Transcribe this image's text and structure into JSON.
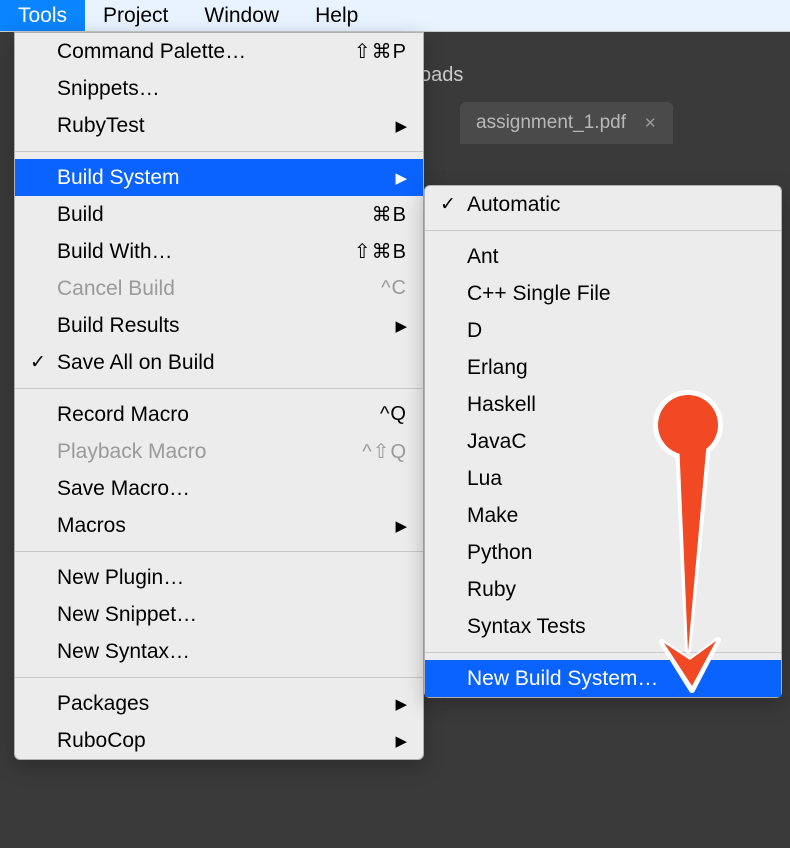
{
  "menubar": {
    "items": [
      {
        "label": "Tools",
        "active": true
      },
      {
        "label": "Project",
        "active": false
      },
      {
        "label": "Window",
        "active": false
      },
      {
        "label": "Help",
        "active": false
      }
    ]
  },
  "breadcrumb": "oads",
  "tab": {
    "label": "assignment_1.pdf",
    "close_glyph": "✕"
  },
  "tools_menu": {
    "groups": [
      [
        {
          "label": "Command Palette…",
          "shortcut": "⇧⌘P"
        },
        {
          "label": "Snippets…"
        },
        {
          "label": "RubyTest",
          "submenu": true
        }
      ],
      [
        {
          "label": "Build System",
          "submenu": true,
          "highlighted": true
        },
        {
          "label": "Build",
          "shortcut": "⌘B"
        },
        {
          "label": "Build With…",
          "shortcut": "⇧⌘B"
        },
        {
          "label": "Cancel Build",
          "shortcut": "^C",
          "disabled": true
        },
        {
          "label": "Build Results",
          "submenu": true
        },
        {
          "label": "Save All on Build",
          "checked": true
        }
      ],
      [
        {
          "label": "Record Macro",
          "shortcut": "^Q"
        },
        {
          "label": "Playback Macro",
          "shortcut": "^⇧Q",
          "disabled": true
        },
        {
          "label": "Save Macro…"
        },
        {
          "label": "Macros",
          "submenu": true
        }
      ],
      [
        {
          "label": "New Plugin…"
        },
        {
          "label": "New Snippet…"
        },
        {
          "label": "New Syntax…"
        }
      ],
      [
        {
          "label": "Packages",
          "submenu": true
        },
        {
          "label": "RuboCop",
          "submenu": true
        }
      ]
    ]
  },
  "build_system_menu": {
    "groups": [
      [
        {
          "label": "Automatic",
          "checked": true
        }
      ],
      [
        {
          "label": "Ant"
        },
        {
          "label": "C++ Single File"
        },
        {
          "label": "D"
        },
        {
          "label": "Erlang"
        },
        {
          "label": "Haskell"
        },
        {
          "label": "JavaC"
        },
        {
          "label": "Lua"
        },
        {
          "label": "Make"
        },
        {
          "label": "Python"
        },
        {
          "label": "Ruby"
        },
        {
          "label": "Syntax Tests"
        }
      ],
      [
        {
          "label": "New Build System…",
          "highlighted": true
        }
      ]
    ]
  },
  "glyphs": {
    "check": "✓",
    "arrow": "▶"
  },
  "annotation": {
    "color": "#f04923"
  }
}
